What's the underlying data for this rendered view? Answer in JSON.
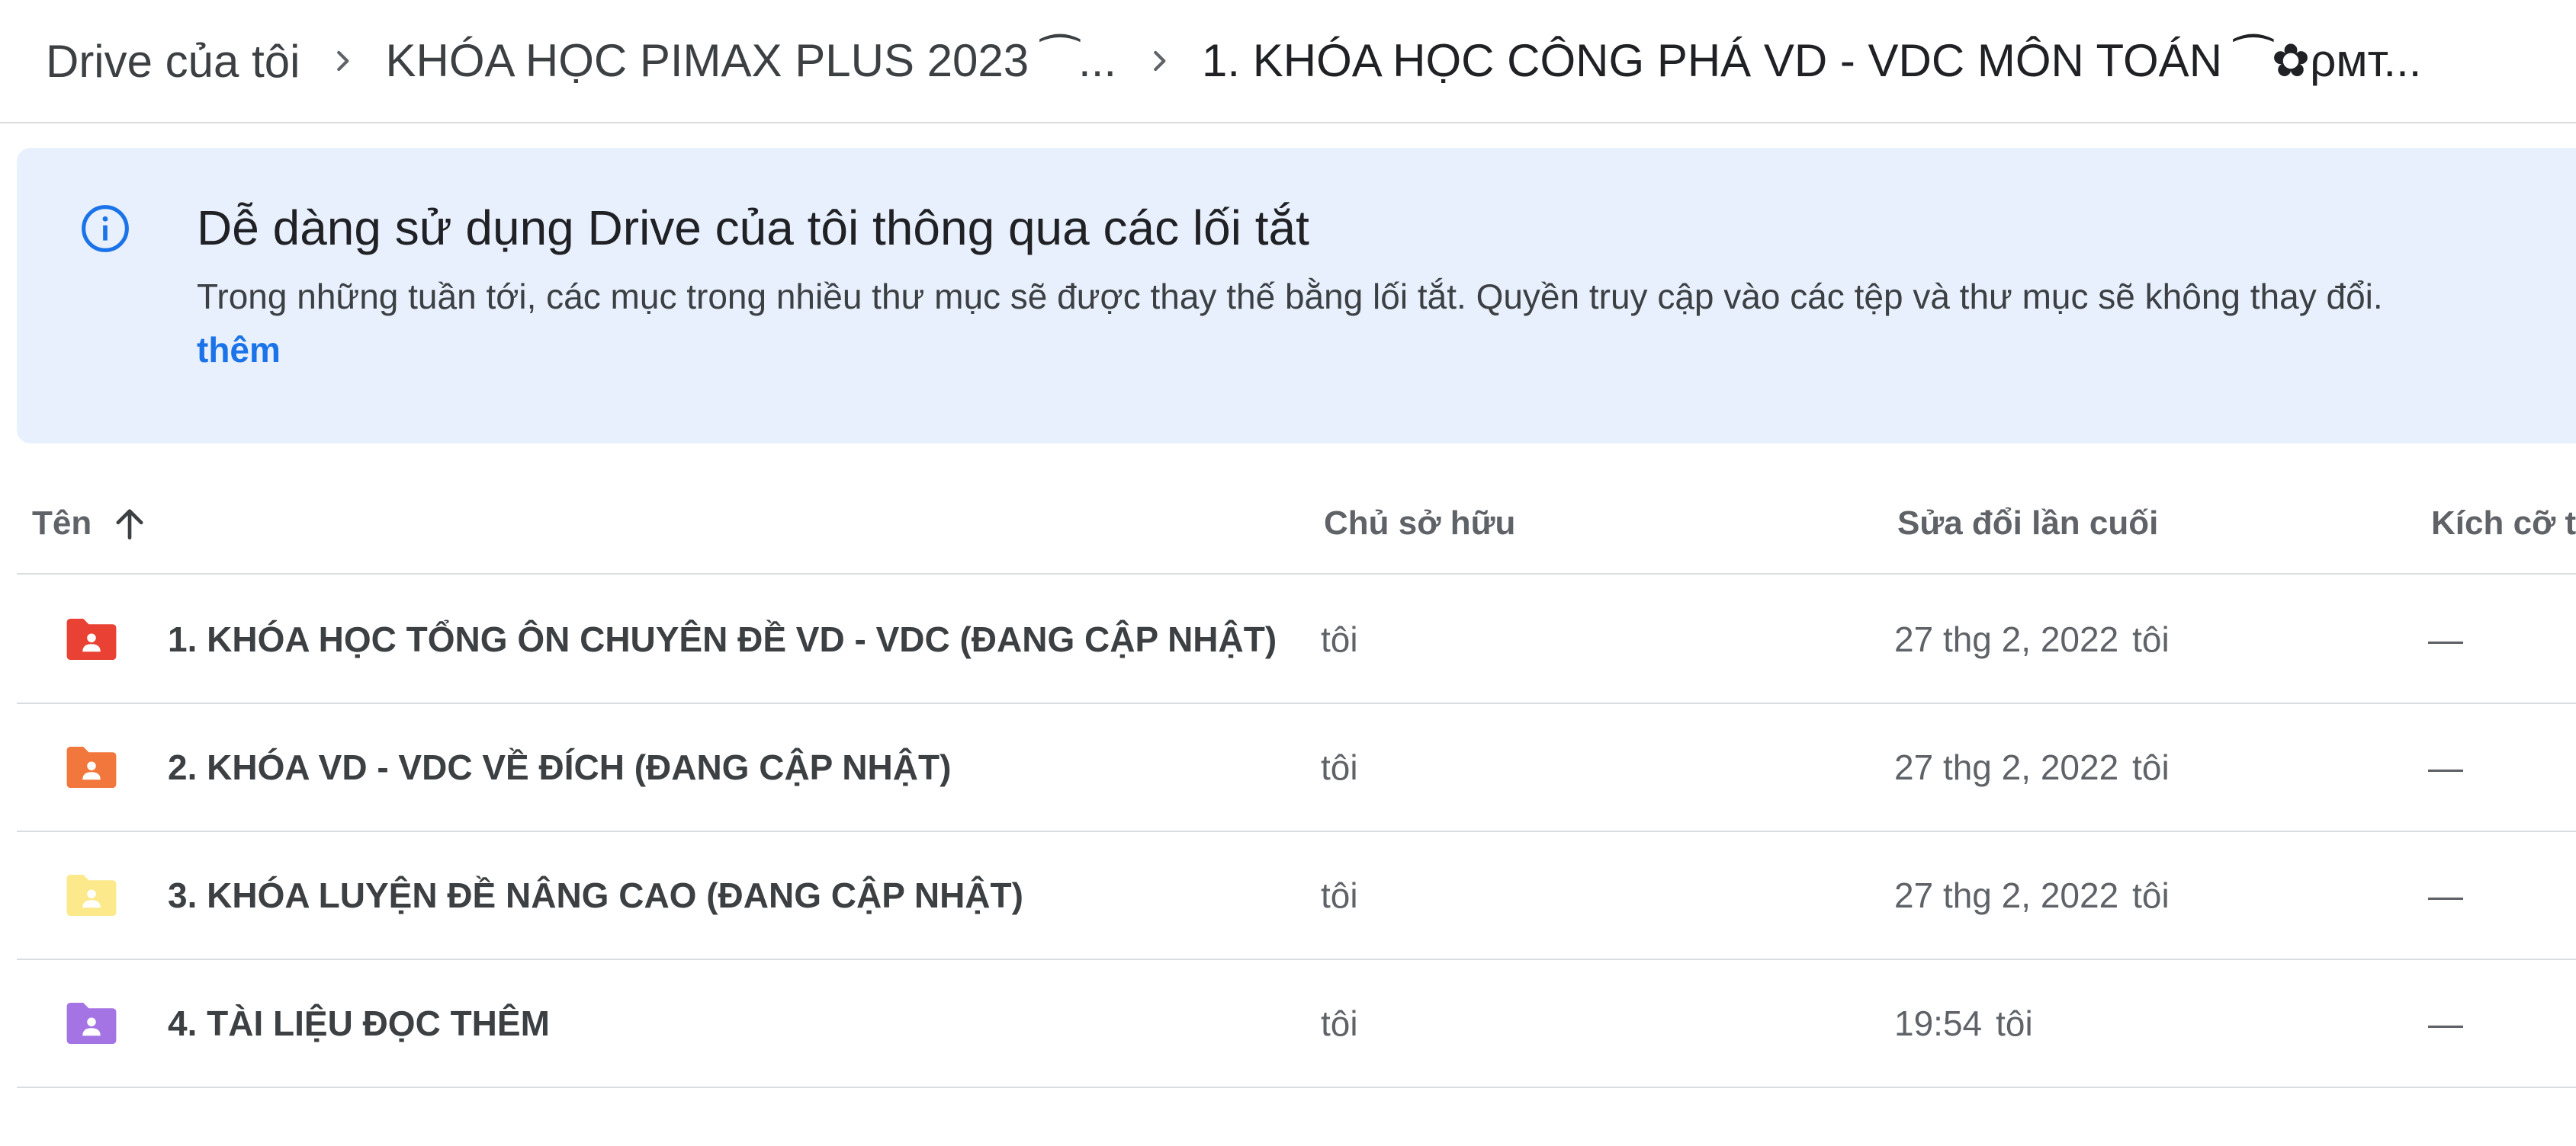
{
  "breadcrumb": {
    "items": [
      {
        "label": "Drive của tôi"
      },
      {
        "label": "KHÓA HỌC PIMAX PLUS 2023 ⁀..."
      },
      {
        "label": "1. KHÓA HỌC CÔNG PHÁ VD - VDC MÔN TOÁN ⁀✿ρмт..."
      }
    ]
  },
  "banner": {
    "title": "Dễ dàng sử dụng Drive của tôi thông qua các lối tắt",
    "text": "Trong những tuần tới, các mục trong nhiều thư mục sẽ được thay thế bằng lối tắt. Quyền truy cập vào các tệp và thư mục sẽ không thay đổi.",
    "link": "thêm",
    "icon": "info-icon",
    "accent": "#1a73e8",
    "background": "#e8f0fe"
  },
  "table": {
    "headers": {
      "name": "Tên",
      "owner": "Chủ sở hữu",
      "modified": "Sửa đổi lần cuối",
      "size": "Kích cỡ tệ"
    },
    "sort_icon": "arrow-up-icon",
    "rows": [
      {
        "name": "1. KHÓA HỌC TỔNG ÔN CHUYÊN ĐỀ VD - VDC (ĐANG CẬP NHẬT)",
        "owner": "tôi",
        "modified": "27 thg 2, 2022",
        "modified_by": "tôi",
        "size": "—",
        "folder_color": "#e94235"
      },
      {
        "name": "2. KHÓA VD - VDC VỀ ĐÍCH (ĐANG CẬP NHẬT)",
        "owner": "tôi",
        "modified": "27 thg 2, 2022",
        "modified_by": "tôi",
        "size": "—",
        "folder_color": "#f1773d"
      },
      {
        "name": "3. KHÓA LUYỆN ĐỀ NÂNG CAO (ĐANG CẬP NHẬT)",
        "owner": "tôi",
        "modified": "27 thg 2, 2022",
        "modified_by": "tôi",
        "size": "—",
        "folder_color": "#fbe98c"
      },
      {
        "name": "4. TÀI LIỆU ĐỌC THÊM",
        "owner": "tôi",
        "modified": "19:54",
        "modified_by": "tôi",
        "size": "—",
        "folder_color": "#a474e4"
      }
    ]
  }
}
